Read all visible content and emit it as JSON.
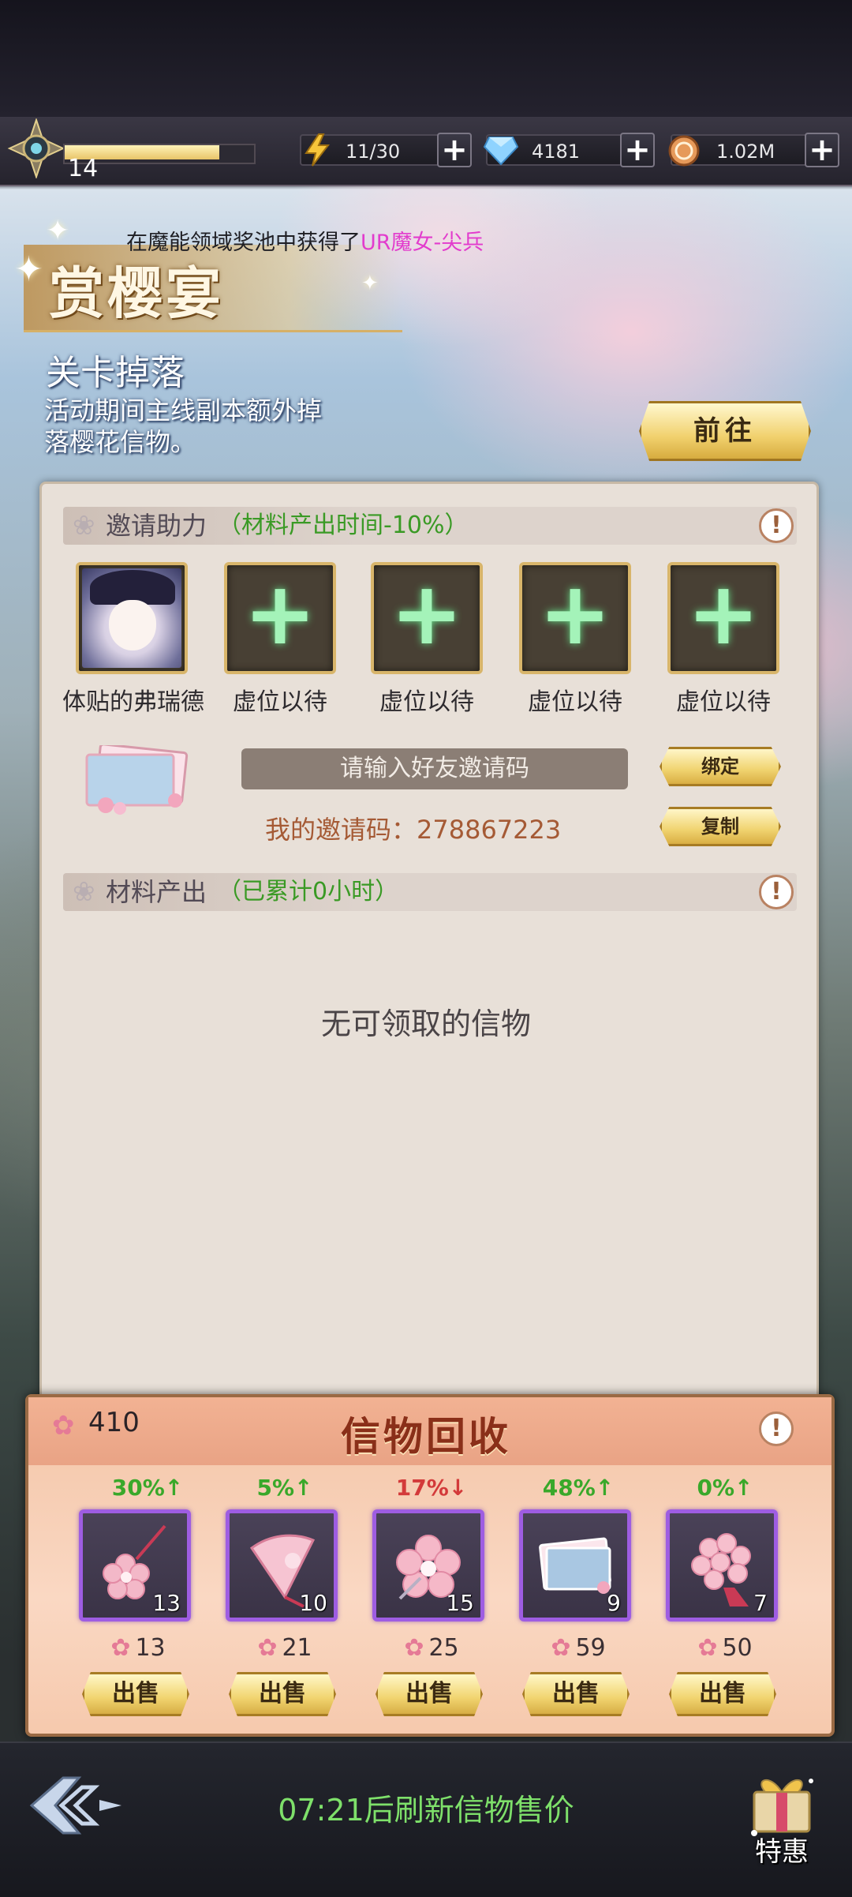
{
  "top_bar": {
    "level": "14",
    "xp_fraction": 0.83,
    "energy": "11/30",
    "diamonds": "4181",
    "coins": "1.02M",
    "plus_label": "+"
  },
  "notice": {
    "prefix": "在魔能领域奖池中获得了",
    "highlight": "UR魔女-尖兵"
  },
  "event": {
    "title": "赏樱宴",
    "drop_title": "关卡掉落",
    "drop_desc": "活动期间主线副本额外掉落樱花信物。",
    "goto_label": "前往"
  },
  "invite": {
    "section_title": "邀请助力",
    "section_sub": "（材料产出时间-10%）",
    "slots": [
      {
        "label": "体贴的弗瑞德",
        "filled": true
      },
      {
        "label": "虚位以待",
        "filled": false
      },
      {
        "label": "虚位以待",
        "filled": false
      },
      {
        "label": "虚位以待",
        "filled": false
      },
      {
        "label": "虚位以待",
        "filled": false
      }
    ],
    "input_placeholder": "请输入好友邀请码",
    "bind_label": "绑定",
    "copy_label": "复制",
    "my_code": "我的邀请码：278867223"
  },
  "material": {
    "section_title": "材料产出",
    "section_sub": "（已累计0小时）",
    "empty_text": "无可领取的信物"
  },
  "recycle": {
    "title": "信物回收",
    "points": "410",
    "items": [
      {
        "icon": "sakura-pendant",
        "change": "30%↑",
        "trend": "up",
        "count": "13",
        "price": "13",
        "sell": "出售"
      },
      {
        "icon": "sakura-fan",
        "change": "5%↑",
        "trend": "up",
        "count": "10",
        "price": "21",
        "sell": "出售"
      },
      {
        "icon": "sakura-hairpin",
        "change": "17%↓",
        "trend": "down",
        "count": "15",
        "price": "25",
        "sell": "出售"
      },
      {
        "icon": "sakura-photos",
        "change": "48%↑",
        "trend": "up",
        "count": "9",
        "price": "59",
        "sell": "出售"
      },
      {
        "icon": "sakura-bouquet",
        "change": "0%↑",
        "trend": "up",
        "count": "7",
        "price": "50",
        "sell": "出售"
      }
    ]
  },
  "bottom": {
    "refresh_text": "07:21后刷新信物售价",
    "deal_label": "特惠"
  },
  "colors": {
    "accent_gold": "#f1d36f",
    "up_green": "#39a82a",
    "down_red": "#d33a3a",
    "highlight_pink": "#e23ccd",
    "item_frame_purple": "#9e5de2"
  }
}
